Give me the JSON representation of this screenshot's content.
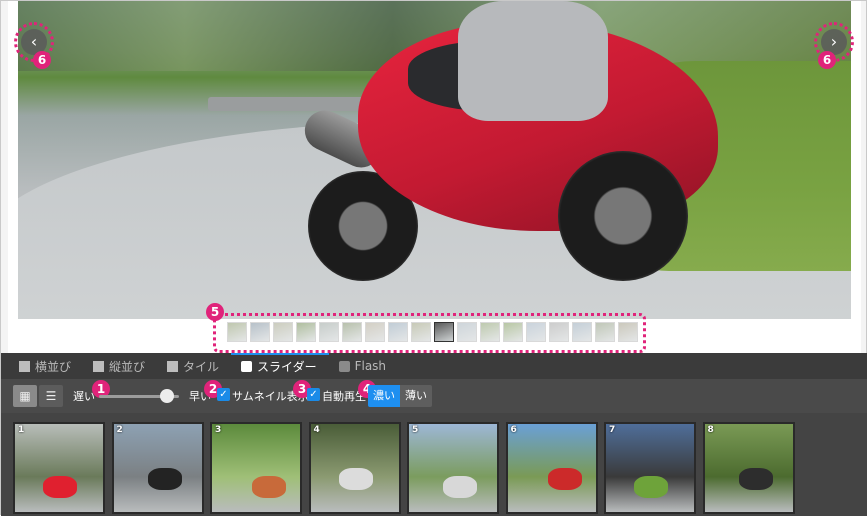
{
  "viewer": {
    "prev_label": "‹",
    "next_label": "›",
    "callout_6": "6",
    "callout_5": "5",
    "thumb_count": 18,
    "active_thumb_index": 9
  },
  "tabs": [
    {
      "label": "横並び",
      "icon": "grid-icon",
      "active": false
    },
    {
      "label": "縦並び",
      "icon": "grid-icon",
      "active": false
    },
    {
      "label": "タイル",
      "icon": "tile-icon",
      "active": false
    },
    {
      "label": "スライダー",
      "icon": "slider-icon",
      "active": true
    },
    {
      "label": "Flash",
      "icon": "flash-icon",
      "active": false
    }
  ],
  "controls": {
    "view_grid_icon": "▦",
    "view_list_icon": "☰",
    "speed_slow": "遅い",
    "speed_fast": "早い",
    "speed_level": 0.85,
    "thumbnail_label": "サムネイル表示",
    "autoplay_label": "自動再生",
    "checkbox_mark": "✓",
    "theme_dark": "濃い",
    "theme_light": "薄い",
    "theme_selected": "濃い",
    "callout_1": "1",
    "callout_2": "2",
    "callout_3": "3",
    "callout_4": "4"
  },
  "thumbnails": [
    {
      "num": "1",
      "bg1": "#b8bdb9",
      "bg2": "#6a7a5a",
      "bike": "#e0202f"
    },
    {
      "num": "2",
      "bg1": "#8da1b3",
      "bg2": "#7b8083",
      "bike": "#232323"
    },
    {
      "num": "3",
      "bg1": "#5c8a3c",
      "bg2": "#9fbf77",
      "bike": "#c86a3a"
    },
    {
      "num": "4",
      "bg1": "#4a5d38",
      "bg2": "#8b9a71",
      "bike": "#dcdcdc"
    },
    {
      "num": "5",
      "bg1": "#9db7d6",
      "bg2": "#7b9c5e",
      "bike": "#d8d8d8"
    },
    {
      "num": "6",
      "bg1": "#6aa0d6",
      "bg2": "#7a9a55",
      "bike": "#cc2a2a"
    },
    {
      "num": "7",
      "bg1": "#4f6e9a",
      "bg2": "#3a3a3a",
      "bike": "#6ea33a"
    },
    {
      "num": "8",
      "bg1": "#7a9a55",
      "bg2": "#4c6b2f",
      "bike": "#2d2d2d"
    }
  ],
  "colors": {
    "accent_pink": "#e0237a",
    "accent_blue": "#1e8ff0"
  }
}
